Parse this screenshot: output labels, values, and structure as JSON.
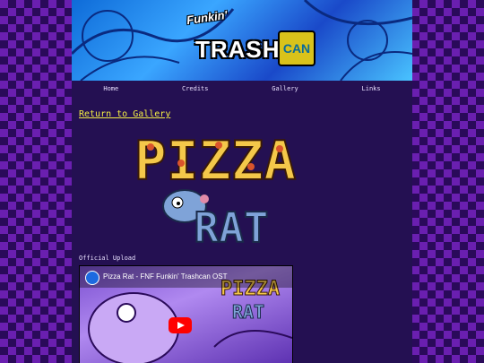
{
  "banner": {
    "logo_small": "Funkin'",
    "logo_main": "TRASH",
    "logo_can": "CAN"
  },
  "nav": {
    "items": [
      "Home",
      "Credits",
      "Gallery",
      "Links"
    ]
  },
  "main": {
    "return_link": "Return to Gallery",
    "art_word1": "PIZZA",
    "art_word2": "RAT",
    "caption": "Official Upload"
  },
  "video": {
    "title": "Pizza Rat - FNF Funkin' Trashcan OST",
    "thumb_word1": "PIZZA",
    "thumb_word2": "RAT"
  },
  "colors": {
    "page_bg": "#241052",
    "checker_light": "#6a1fb0",
    "checker_dark": "#2a0a5a",
    "link_yellow": "#f5ef44",
    "cheese": "#f4c84a",
    "pepperoni": "#d9542b",
    "rat_blue": "#7fa3d8"
  }
}
